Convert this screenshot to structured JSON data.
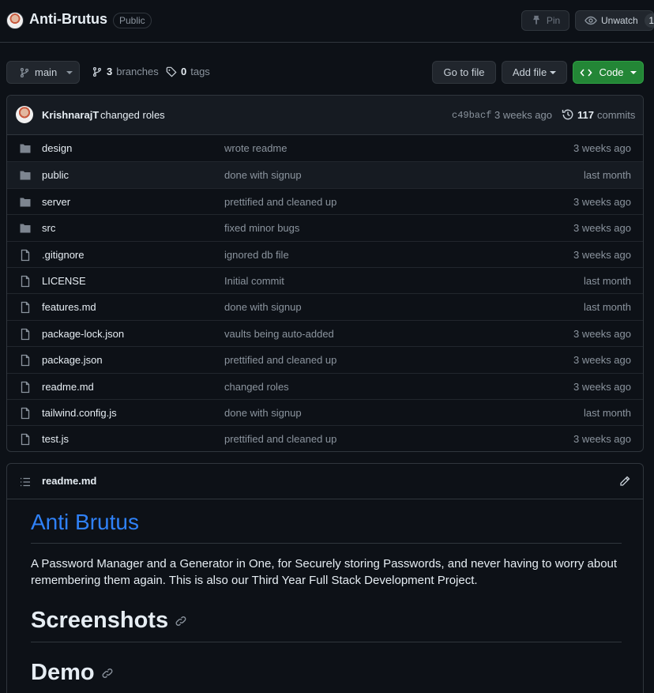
{
  "repo": {
    "name": "Anti-Brutus",
    "visibility": "Public",
    "pin_label": "Pin",
    "unwatch_label": "Unwatch",
    "watch_count": "1"
  },
  "toolbar": {
    "branch": "main",
    "branches_count": "3",
    "branches_label": "branches",
    "tags_count": "0",
    "tags_label": "tags",
    "goto_file": "Go to file",
    "add_file": "Add file",
    "code": "Code"
  },
  "latest_commit": {
    "author": "KrishnarajT",
    "message": "changed roles",
    "sha": "c49bacf",
    "time": "3 weeks ago",
    "commit_count": "117",
    "commits_label": "commits"
  },
  "files": [
    {
      "type": "dir",
      "name": "design",
      "commit": "wrote readme",
      "age": "3 weeks ago"
    },
    {
      "type": "dir",
      "name": "public",
      "commit": "done with signup",
      "age": "last month"
    },
    {
      "type": "dir",
      "name": "server",
      "commit": "prettified and cleaned up",
      "age": "3 weeks ago"
    },
    {
      "type": "dir",
      "name": "src",
      "commit": "fixed minor bugs",
      "age": "3 weeks ago"
    },
    {
      "type": "file",
      "name": ".gitignore",
      "commit": "ignored db file",
      "age": "3 weeks ago"
    },
    {
      "type": "file",
      "name": "LICENSE",
      "commit": "Initial commit",
      "age": "last month"
    },
    {
      "type": "file",
      "name": "features.md",
      "commit": "done with signup",
      "age": "last month"
    },
    {
      "type": "file",
      "name": "package-lock.json",
      "commit": "vaults being auto-added",
      "age": "3 weeks ago"
    },
    {
      "type": "file",
      "name": "package.json",
      "commit": "prettified and cleaned up",
      "age": "3 weeks ago"
    },
    {
      "type": "file",
      "name": "readme.md",
      "commit": "changed roles",
      "age": "3 weeks ago"
    },
    {
      "type": "file",
      "name": "tailwind.config.js",
      "commit": "done with signup",
      "age": "last month"
    },
    {
      "type": "file",
      "name": "test.js",
      "commit": "prettified and cleaned up",
      "age": "3 weeks ago"
    }
  ],
  "readme": {
    "filename": "readme.md",
    "title": "Anti Brutus",
    "description": "A Password Manager and a Generator in One, for Securely storing Passwords, and never having to worry about remembering them again. This is also our Third Year Full Stack Development Project.",
    "h_screenshots": "Screenshots",
    "h_demo": "Demo"
  },
  "colors": {
    "background": "#0d1117",
    "border": "#30363d",
    "accent_link": "#2f81f7",
    "code_button": "#238636",
    "muted_text": "#8b949e"
  }
}
